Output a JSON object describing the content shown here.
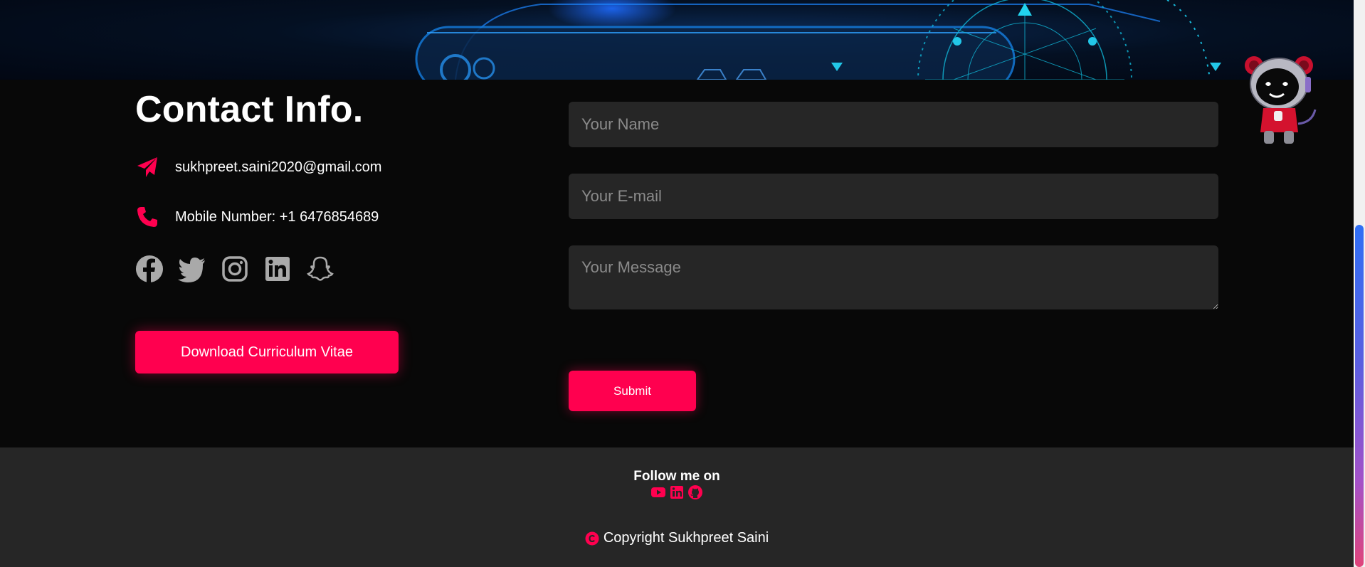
{
  "contact": {
    "title": "Contact Info.",
    "email": "sukhpreet.saini2020@gmail.com",
    "phone": "Mobile Number: +1 6476854689",
    "socials": [
      "facebook-icon",
      "twitter-icon",
      "instagram-icon",
      "linkedin-icon",
      "snapchat-icon"
    ],
    "cv_button": "Download Curriculum Vitae"
  },
  "form": {
    "name_placeholder": "Your Name",
    "email_placeholder": "Your E-mail",
    "message_placeholder": "Your Message",
    "submit_label": "Submit"
  },
  "footer": {
    "follow_label": "Follow me on",
    "icons": [
      "youtube-icon",
      "linkedin-icon",
      "github-icon"
    ],
    "copyright": "Copyright Sukhpreet Saini"
  },
  "colors": {
    "accent": "#ff004f",
    "background": "#080808",
    "footer_background": "#262626",
    "field_background": "#262626"
  }
}
